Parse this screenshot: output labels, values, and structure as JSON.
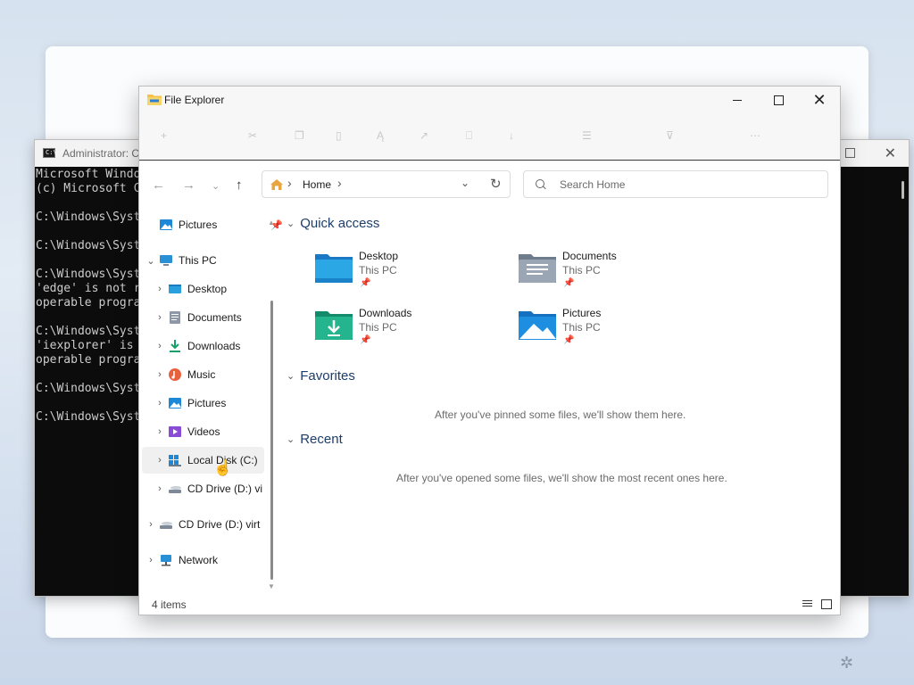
{
  "cmd": {
    "title": "Administrator: C",
    "lines": [
      "Microsoft Windo",
      "(c) Microsoft C",
      "",
      "C:\\Windows\\Syst",
      "",
      "C:\\Windows\\Syst",
      "",
      "C:\\Windows\\Syst",
      "'edge' is not r",
      "operable progra",
      "",
      "C:\\Windows\\Syst",
      "'iexplorer' is",
      "operable progra",
      "",
      "C:\\Windows\\Syst",
      "",
      "C:\\Windows\\Syst"
    ]
  },
  "explorer": {
    "title": "File Explorer",
    "address": {
      "location": "Home"
    },
    "search": {
      "placeholder": "Search Home"
    },
    "sidebar": {
      "pinned_pictures": "Pictures",
      "this_pc": "This PC",
      "items": [
        "Desktop",
        "Documents",
        "Downloads",
        "Music",
        "Pictures",
        "Videos",
        "Local Disk (C:)",
        "CD Drive (D:) vi"
      ],
      "cd_drive": "CD Drive (D:) virt",
      "network": "Network"
    },
    "quick_access": {
      "heading": "Quick access",
      "items": [
        {
          "name": "Desktop",
          "location": "This PC",
          "icon": "desktop-folder-icon"
        },
        {
          "name": "Documents",
          "location": "This PC",
          "icon": "documents-folder-icon"
        },
        {
          "name": "Downloads",
          "location": "This PC",
          "icon": "downloads-folder-icon"
        },
        {
          "name": "Pictures",
          "location": "This PC",
          "icon": "pictures-folder-icon"
        }
      ]
    },
    "favorites": {
      "heading": "Favorites",
      "empty_message": "After you've pinned some files, we'll show them here."
    },
    "recent": {
      "heading": "Recent",
      "empty_message": "After you've opened some files, we'll show the most recent ones here."
    },
    "status": {
      "item_count": "4 items"
    }
  },
  "colors": {
    "accent": "#1d3d6b",
    "folder_blue": "#2a8fd6",
    "folder_teal": "#1fa884"
  }
}
